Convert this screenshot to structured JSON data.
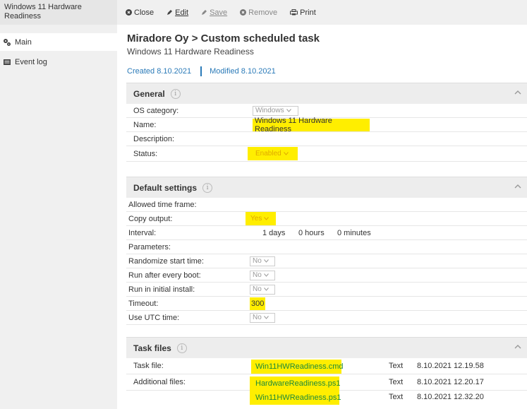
{
  "sidebar": {
    "title": "Windows 11 Hardware Readiness",
    "items": [
      {
        "label": "Main",
        "icon": "gears-icon"
      },
      {
        "label": "Event log",
        "icon": "log-icon"
      }
    ]
  },
  "toolbar": {
    "close": "Close",
    "edit": "Edit",
    "save": "Save",
    "remove": "Remove",
    "print": "Print"
  },
  "header": {
    "title": "Miradore Oy > Custom scheduled task",
    "subtitle": "Windows 11 Hardware Readiness",
    "created": "Created 8.10.2021",
    "modified": "Modified 8.10.2021"
  },
  "general": {
    "title": "General",
    "os_category_label": "OS category:",
    "os_category_value": "Windows",
    "name_label": "Name:",
    "name_value": "Windows 11 Hardware Readiness",
    "description_label": "Description:",
    "status_label": "Status:",
    "status_value": "Enabled"
  },
  "defaults": {
    "title": "Default settings",
    "allowed_label": "Allowed time frame:",
    "copy_label": "Copy output:",
    "copy_value": "Yes",
    "interval_label": "Interval:",
    "interval_days": "1 days",
    "interval_hours": "0 hours",
    "interval_minutes": "0 minutes",
    "parameters_label": "Parameters:",
    "randomize_label": "Randomize start time:",
    "randomize_value": "No",
    "reboot_label": "Run after every boot:",
    "reboot_value": "No",
    "initial_label": "Run in initial install:",
    "initial_value": "No",
    "timeout_label": "Timeout:",
    "timeout_value": "300",
    "utc_label": "Use UTC time:",
    "utc_value": "No"
  },
  "taskfiles": {
    "title": "Task files",
    "task_file_label": "Task file:",
    "additional_label": "Additional files:",
    "files": [
      {
        "name": "Win11HWReadiness.cmd",
        "type": "Text",
        "date": "8.10.2021 12.19.58"
      },
      {
        "name": "HardwareReadiness.ps1",
        "type": "Text",
        "date": "8.10.2021 12.20.17"
      },
      {
        "name": "Win11HWReadiness.ps1",
        "type": "Text",
        "date": "8.10.2021 12.32.20"
      }
    ]
  },
  "colors": {
    "highlight": "#ffee00",
    "link": "#2a7ab8",
    "file_link": "#1d8a3a"
  }
}
